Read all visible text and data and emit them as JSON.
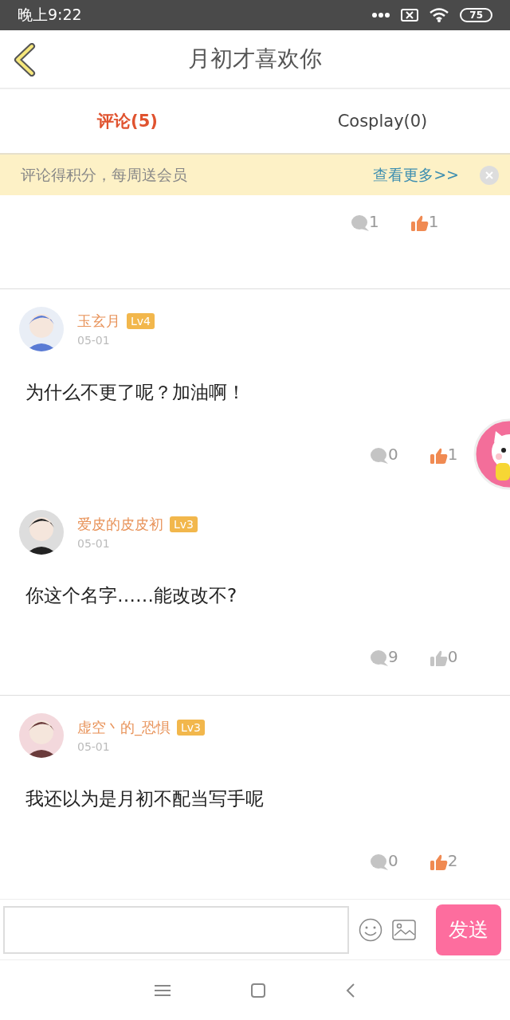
{
  "status_bar": {
    "time": "晚上9:22",
    "battery": "75"
  },
  "header": {
    "title": "月初才喜欢你"
  },
  "tabs": [
    {
      "label": "评论(5)",
      "selected": true
    },
    {
      "label": "Cosplay(0)",
      "selected": false
    }
  ],
  "banner": {
    "text": "评论得积分，每周送会员",
    "link": "查看更多>>"
  },
  "partial_comment": {
    "replies": "1",
    "likes": "1",
    "liked": true
  },
  "comments": [
    {
      "user": "玉玄月",
      "level": "Lv4",
      "date": "05-01",
      "text": "为什么不更了呢？加油啊！",
      "replies": "0",
      "likes": "1",
      "liked": true
    },
    {
      "user": "爱皮的皮皮初",
      "level": "Lv3",
      "date": "05-01",
      "text": "你这个名字……能改改不?",
      "replies": "9",
      "likes": "0",
      "liked": false
    },
    {
      "user": "虚空丶的_恐惧",
      "level": "Lv3",
      "date": "05-01",
      "text": "我还以为是月初不配当写手呢",
      "replies": "0",
      "likes": "2",
      "liked": true
    }
  ],
  "composer": {
    "send": "发送"
  }
}
